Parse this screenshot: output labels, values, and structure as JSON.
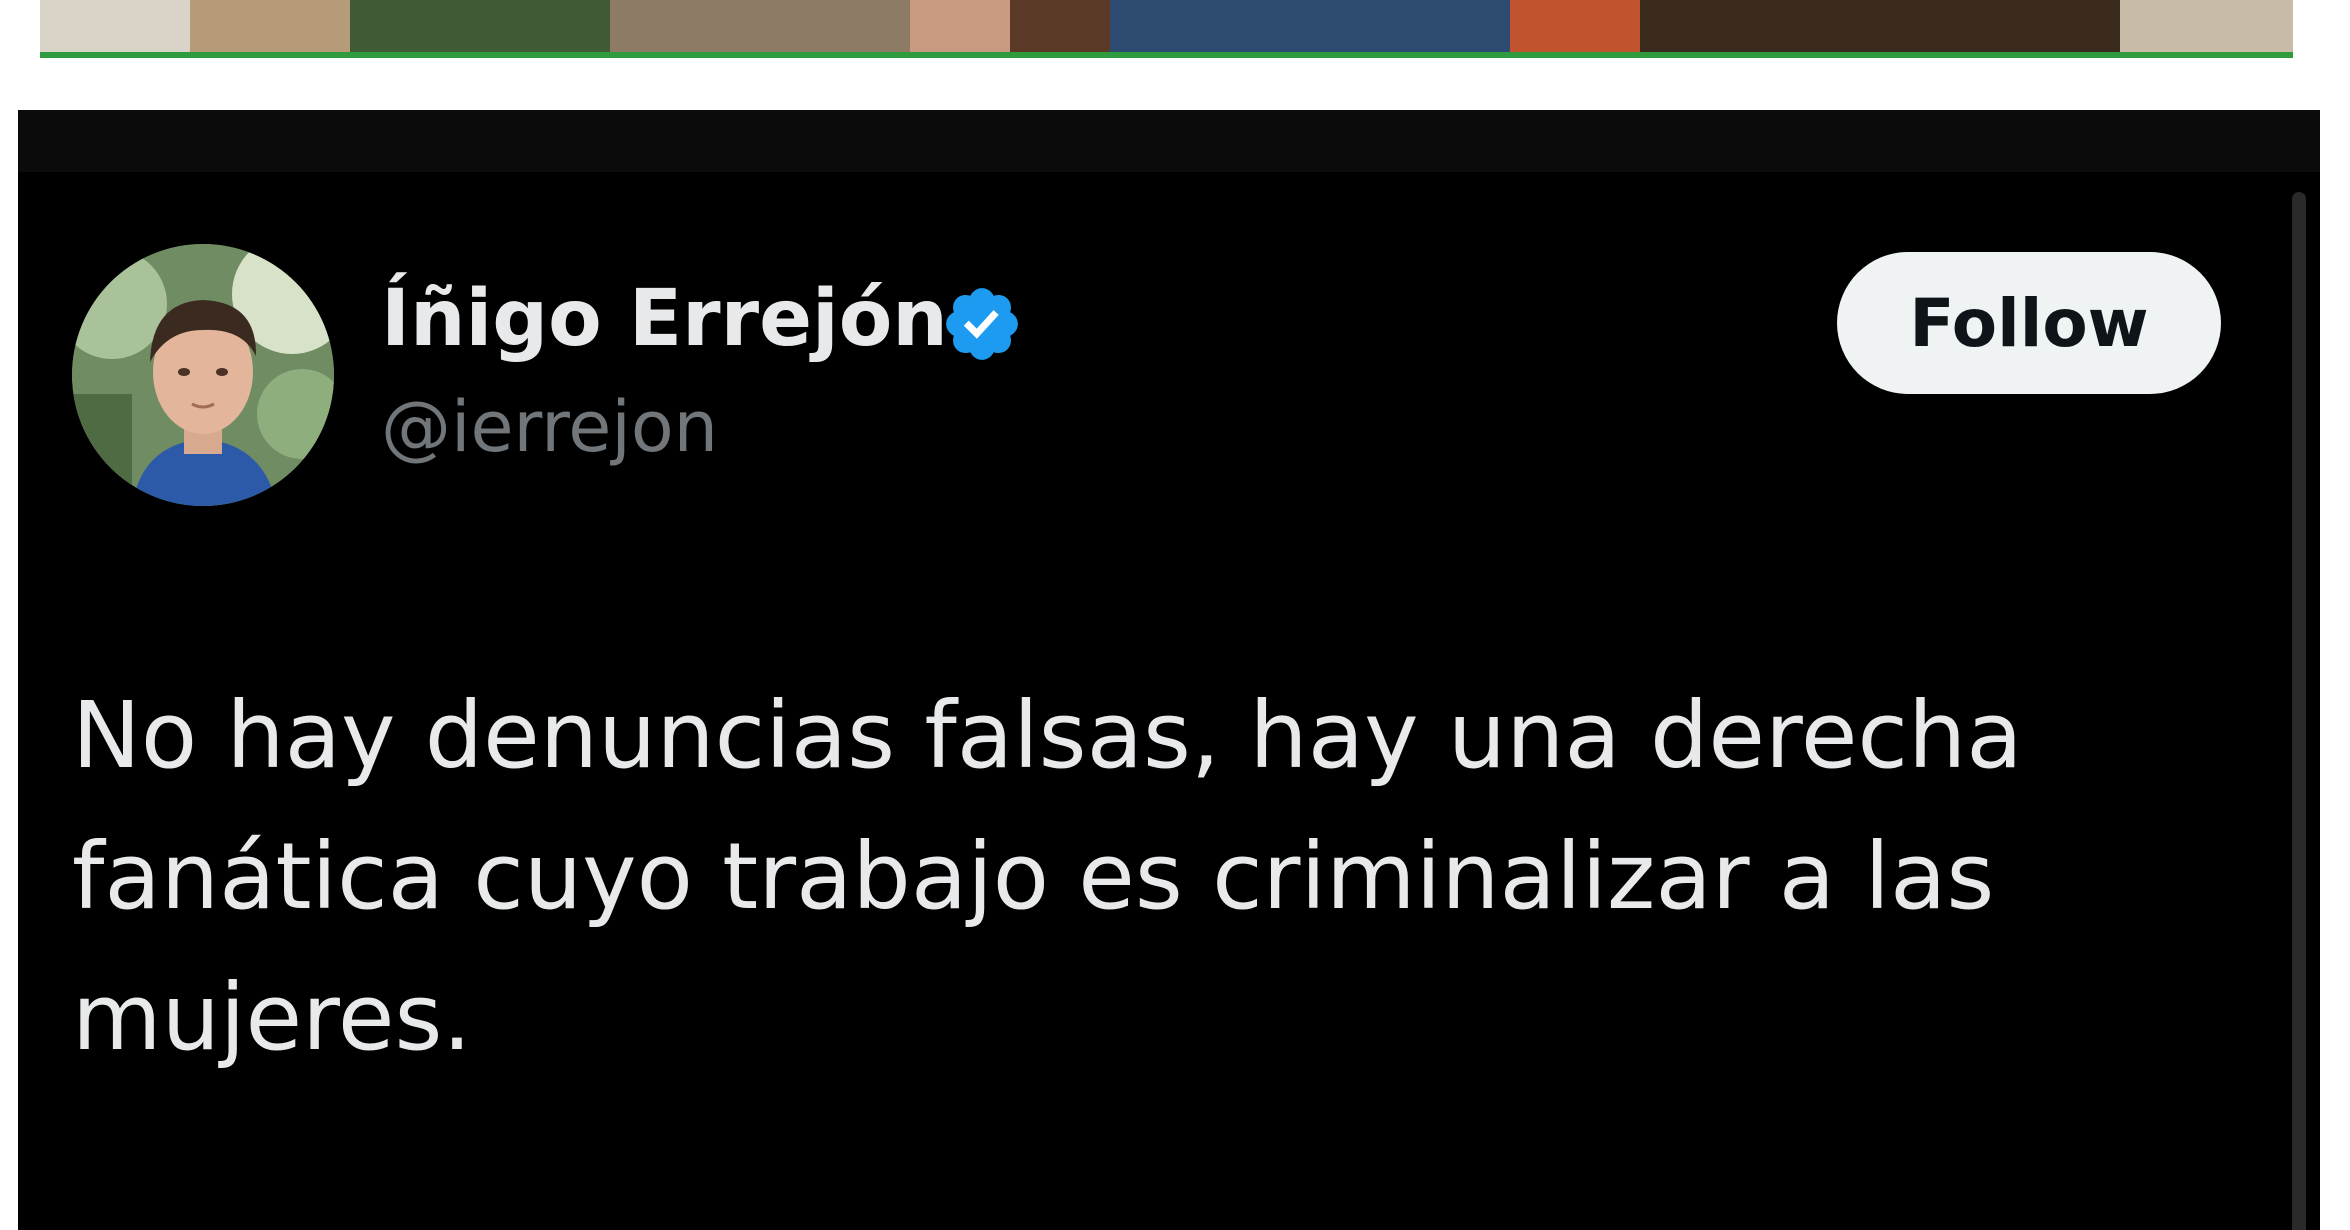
{
  "tweet": {
    "display_name": "Íñigo Errejón",
    "handle": "@ierrejon",
    "verified": true,
    "follow_label": "Follow",
    "text": "No hay denuncias falsas, hay una derecha fanática cuyo trabajo es criminalizar a las mujeres."
  },
  "icons": {
    "verified": "verified-badge-icon",
    "avatar": "profile-photo"
  },
  "colors": {
    "card_background": "#000000",
    "text_primary": "#e7e9ea",
    "text_secondary": "#71767b",
    "verified_blue": "#1d9bf0",
    "follow_button_bg": "#eff3f4",
    "photo_border_green": "#2f9b3f"
  }
}
